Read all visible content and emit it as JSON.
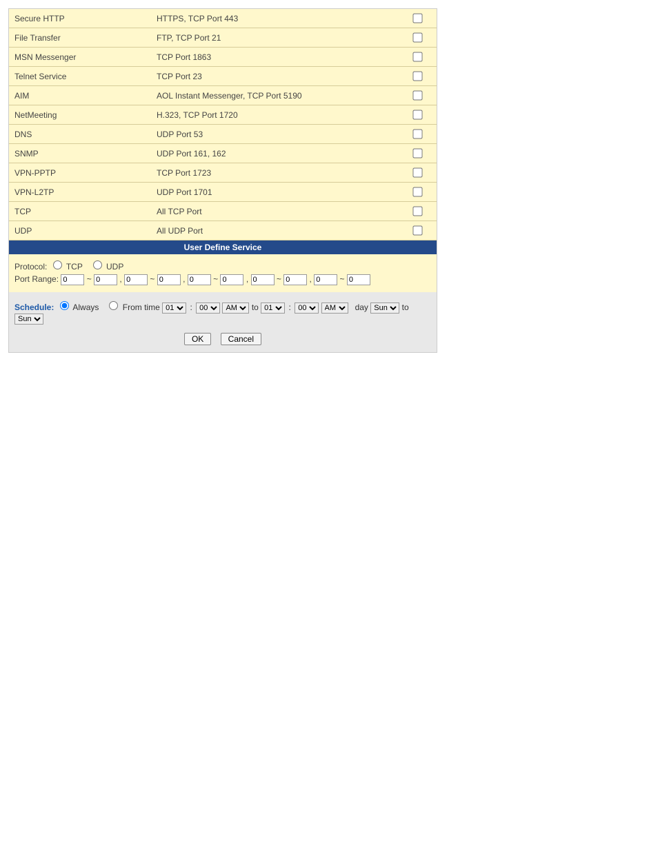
{
  "services": [
    {
      "name": "Secure HTTP",
      "desc": "HTTPS, TCP Port 443",
      "checked": false
    },
    {
      "name": "File Transfer",
      "desc": "FTP, TCP Port 21",
      "checked": false
    },
    {
      "name": "MSN Messenger",
      "desc": "TCP Port 1863",
      "checked": false
    },
    {
      "name": "Telnet Service",
      "desc": "TCP Port 23",
      "checked": false
    },
    {
      "name": "AIM",
      "desc": "AOL Instant Messenger, TCP Port 5190",
      "checked": false
    },
    {
      "name": "NetMeeting",
      "desc": "H.323, TCP Port 1720",
      "checked": false
    },
    {
      "name": "DNS",
      "desc": "UDP Port 53",
      "checked": false
    },
    {
      "name": "SNMP",
      "desc": "UDP Port 161, 162",
      "checked": false
    },
    {
      "name": "VPN-PPTP",
      "desc": "TCP Port 1723",
      "checked": false
    },
    {
      "name": "VPN-L2TP",
      "desc": "UDP Port 1701",
      "checked": false
    },
    {
      "name": "TCP",
      "desc": "All TCP Port",
      "checked": false
    },
    {
      "name": "UDP",
      "desc": "All UDP Port",
      "checked": false
    }
  ],
  "userDefineHeader": "User Define Service",
  "define": {
    "protocolLabel": "Protocol:",
    "tcpLabel": "TCP",
    "udpLabel": "UDP",
    "protocol": "",
    "portRangeLabel": "Port Range:",
    "ranges": [
      {
        "from": "0",
        "to": "0"
      },
      {
        "from": "0",
        "to": "0"
      },
      {
        "from": "0",
        "to": "0"
      },
      {
        "from": "0",
        "to": "0"
      },
      {
        "from": "0",
        "to": "0"
      }
    ],
    "tilde": "~",
    "comma": ","
  },
  "schedule": {
    "label": "Schedule:",
    "alwaysLabel": "Always",
    "fromTimeLabel": "From time",
    "mode": "always",
    "hour1": "01",
    "min1": "00",
    "ampm1": "AM",
    "toText": "to",
    "hour2": "01",
    "min2": "00",
    "ampm2": "AM",
    "dayText": "day",
    "toText2": "to",
    "day1": "Sun",
    "day2": "Sun",
    "colon": ":"
  },
  "buttons": {
    "ok": "OK",
    "cancel": "Cancel"
  }
}
